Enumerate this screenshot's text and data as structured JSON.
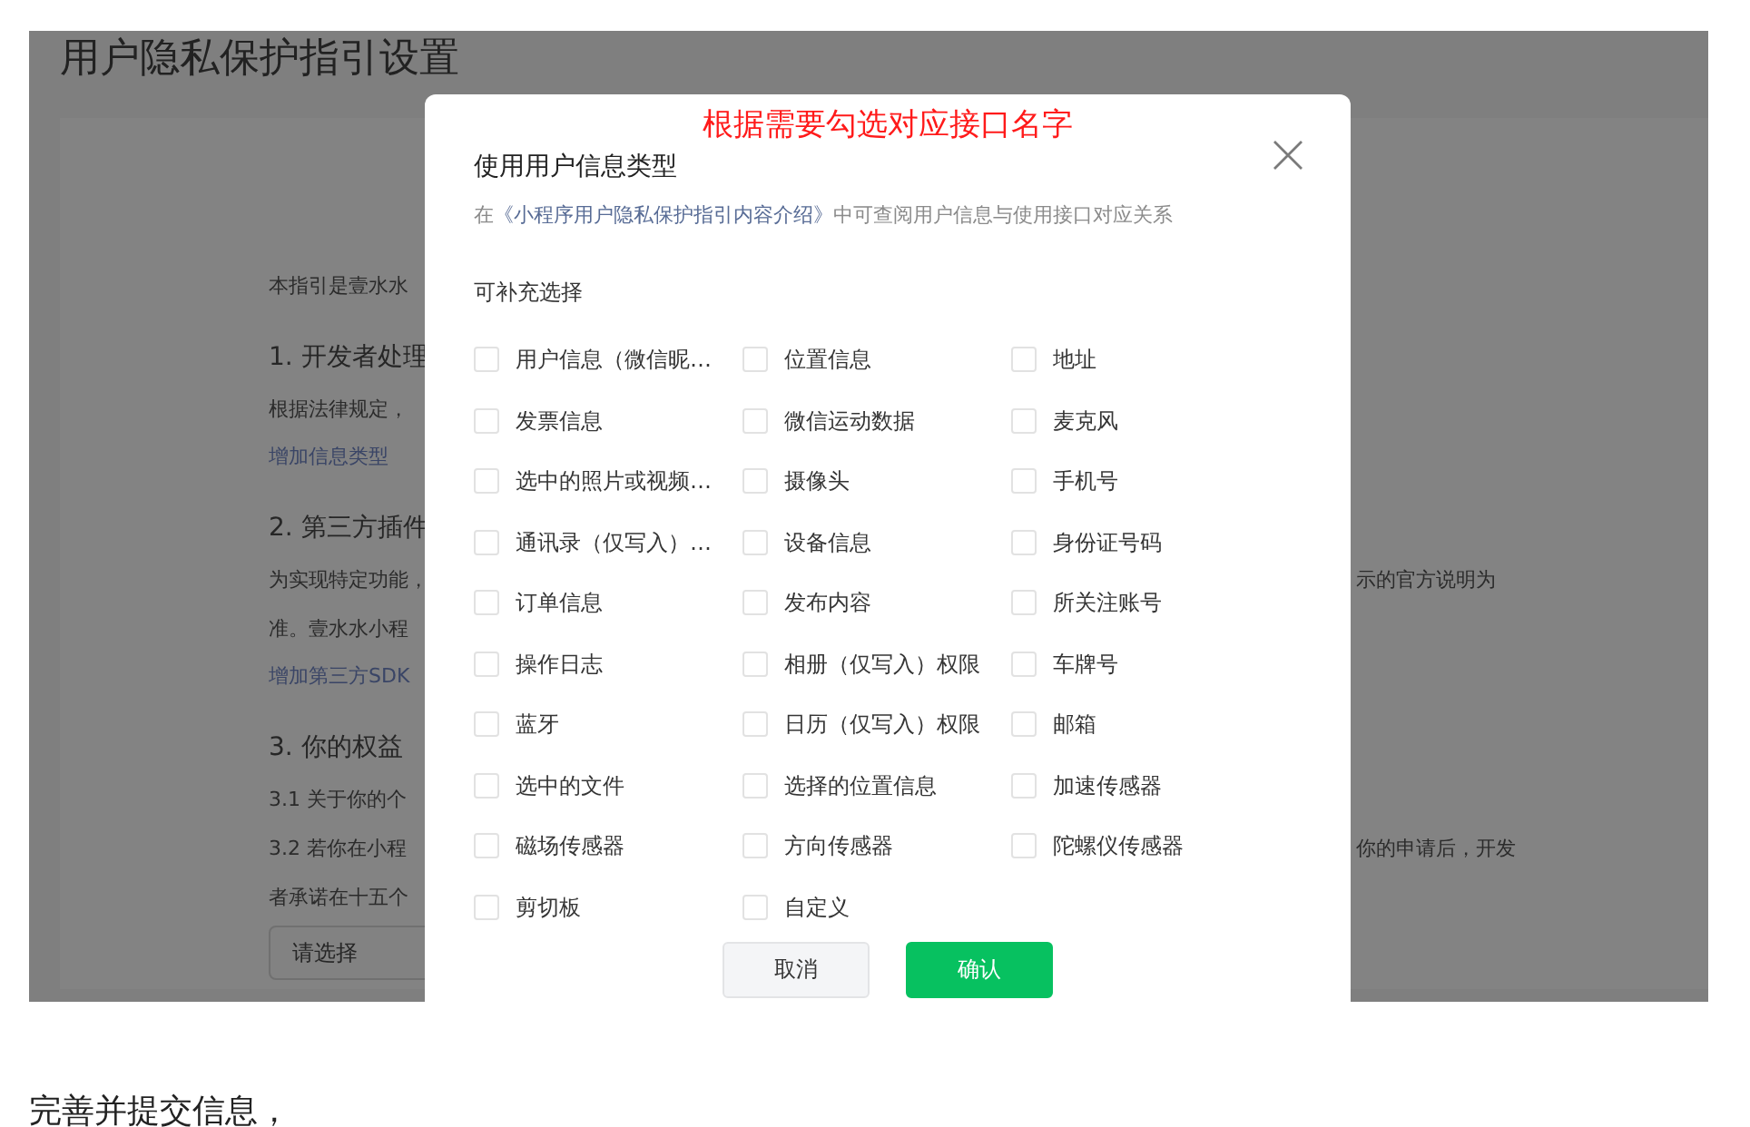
{
  "background_page": {
    "title": "用户隐私保护指引设置",
    "rows": [
      {
        "kind": "text",
        "left": "本指引是壹水水"
      },
      {
        "kind": "heading",
        "left": "1.  开发者处理"
      },
      {
        "kind": "text",
        "left": "根据法律规定，"
      },
      {
        "kind": "link",
        "left": "增加信息类型"
      },
      {
        "kind": "heading",
        "left": "2.  第三方插件"
      },
      {
        "kind": "text",
        "left": "为实现特定功能，",
        "right": "示的官方说明为"
      },
      {
        "kind": "text",
        "left": "准。壹水水小程"
      },
      {
        "kind": "link",
        "left": "增加第三方SDK"
      },
      {
        "kind": "heading",
        "left": "3.  你的权益"
      },
      {
        "kind": "text",
        "left": "3.1  关于你的个"
      },
      {
        "kind": "text",
        "left": "3.2  若你在小程",
        "right": "你的申请后，开发"
      },
      {
        "kind": "text",
        "left": "者承诺在十五个"
      },
      {
        "kind": "select",
        "left": "请选择"
      }
    ]
  },
  "dialog": {
    "annotation": "根据需要勾选对应接口名字",
    "title": "使用用户信息类型",
    "hint": {
      "prefix": "在",
      "link": "《小程序用户隐私保护指引内容介绍》",
      "suffix": "中可查阅用户信息与使用接口对应关系"
    },
    "section": "可补充选择",
    "options": [
      {
        "label": "用户信息（微信昵…",
        "checked": false
      },
      {
        "label": "位置信息",
        "checked": false
      },
      {
        "label": "地址",
        "checked": false
      },
      {
        "label": "发票信息",
        "checked": false
      },
      {
        "label": "微信运动数据",
        "checked": false
      },
      {
        "label": "麦克风",
        "checked": false
      },
      {
        "label": "选中的照片或视频…",
        "checked": false
      },
      {
        "label": "摄像头",
        "checked": false
      },
      {
        "label": "手机号",
        "checked": false
      },
      {
        "label": "通讯录（仅写入）…",
        "checked": false
      },
      {
        "label": "设备信息",
        "checked": false
      },
      {
        "label": "身份证号码",
        "checked": false
      },
      {
        "label": "订单信息",
        "checked": false
      },
      {
        "label": "发布内容",
        "checked": false
      },
      {
        "label": "所关注账号",
        "checked": false
      },
      {
        "label": "操作日志",
        "checked": false
      },
      {
        "label": "相册（仅写入）权限",
        "checked": false
      },
      {
        "label": "车牌号",
        "checked": false
      },
      {
        "label": "蓝牙",
        "checked": false
      },
      {
        "label": "日历（仅写入）权限",
        "checked": false
      },
      {
        "label": "邮箱",
        "checked": false
      },
      {
        "label": "选中的文件",
        "checked": false
      },
      {
        "label": "选择的位置信息",
        "checked": false
      },
      {
        "label": "加速传感器",
        "checked": false
      },
      {
        "label": "磁场传感器",
        "checked": false
      },
      {
        "label": "方向传感器",
        "checked": false
      },
      {
        "label": "陀螺仪传感器",
        "checked": false
      },
      {
        "label": "剪切板",
        "checked": false
      },
      {
        "label": "自定义",
        "checked": false
      }
    ],
    "buttons": [
      {
        "label": "取消",
        "kind": "secondary"
      },
      {
        "label": "确认",
        "kind": "primary"
      }
    ]
  },
  "caption": "完善并提交信息，"
}
